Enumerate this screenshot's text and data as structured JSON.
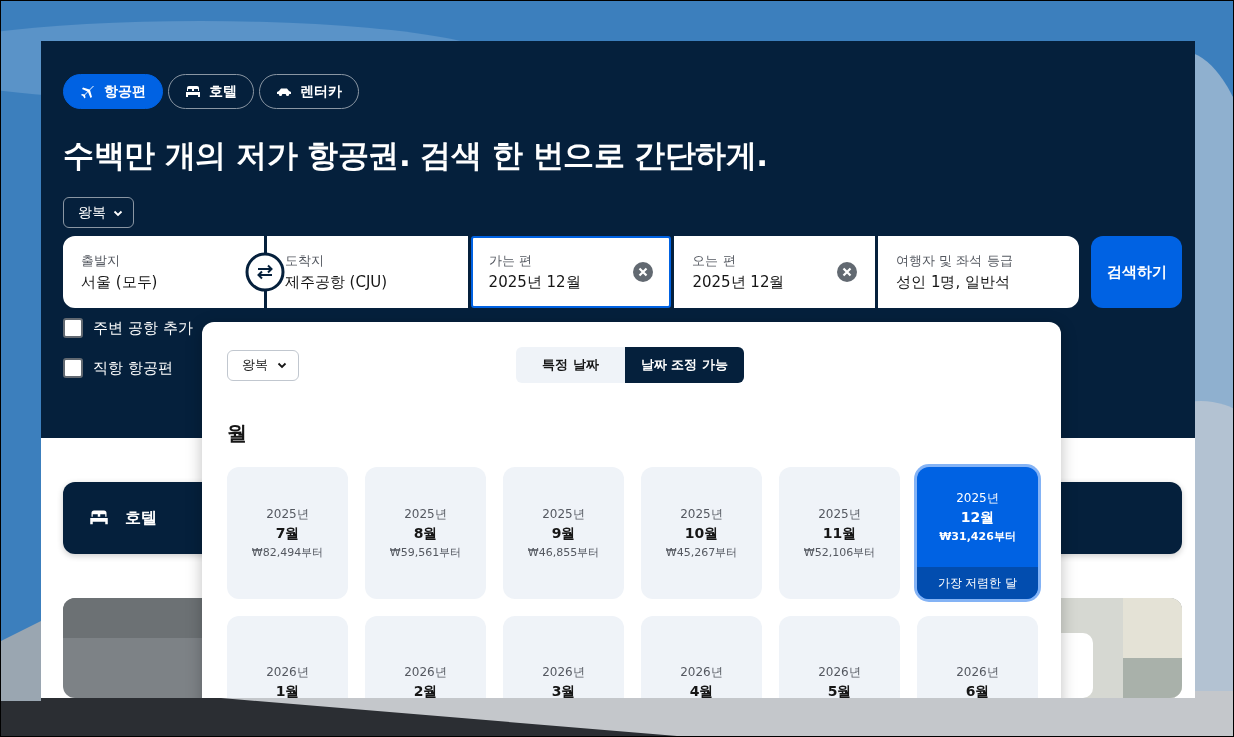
{
  "tabs": [
    {
      "label": "항공편",
      "kind": "plane",
      "selected": true
    },
    {
      "label": "호텔",
      "kind": "bed",
      "selected": false
    },
    {
      "label": "렌터카",
      "kind": "car",
      "selected": false
    }
  ],
  "headline": "수백만 개의 저가 항공권. 검색 한 번으로 간단하게.",
  "trip_type": "왕복",
  "fields": [
    {
      "label": "출발지",
      "value": "서울 (모두)",
      "selected": false,
      "clearable": false
    },
    {
      "label": "도착지",
      "value": "제주공항 (CJU)",
      "selected": false,
      "clearable": false
    },
    {
      "label": "가는 편",
      "value": "2025년 12월",
      "selected": true,
      "clearable": true
    },
    {
      "label": "오는 편",
      "value": "2025년 12월",
      "selected": false,
      "clearable": true
    },
    {
      "label": "여행자 및 좌석 등급",
      "value": "성인 1명, 일반석",
      "selected": false,
      "clearable": false
    }
  ],
  "search_button": "검색하기",
  "options": [
    {
      "label": "주변 공항 추가",
      "checked": false
    },
    {
      "label": "직항 항공편",
      "checked": false
    }
  ],
  "hotel_bar": {
    "label": "호텔"
  },
  "popup": {
    "trip_type": "왕복",
    "modes": [
      {
        "label": "특정 날짜",
        "selected": false
      },
      {
        "label": "날짜 조정 가능",
        "selected": true
      }
    ],
    "heading": "월",
    "months": [
      {
        "year": "2025년",
        "month": "7월",
        "price": "₩82,494부터",
        "selected": false
      },
      {
        "year": "2025년",
        "month": "8월",
        "price": "₩59,561부터",
        "selected": false
      },
      {
        "year": "2025년",
        "month": "9월",
        "price": "₩46,855부터",
        "selected": false
      },
      {
        "year": "2025년",
        "month": "10월",
        "price": "₩45,267부터",
        "selected": false
      },
      {
        "year": "2025년",
        "month": "11월",
        "price": "₩52,106부터",
        "selected": false
      },
      {
        "year": "2025년",
        "month": "12월",
        "price": "₩31,426부터",
        "selected": true,
        "badge": "가장 저렴한 달"
      },
      {
        "year": "2026년",
        "month": "1월",
        "selected": false
      },
      {
        "year": "2026년",
        "month": "2월",
        "selected": false
      },
      {
        "year": "2026년",
        "month": "3월",
        "selected": false
      },
      {
        "year": "2026년",
        "month": "4월",
        "selected": false
      },
      {
        "year": "2026년",
        "month": "5월",
        "selected": false
      },
      {
        "year": "2026년",
        "month": "6월",
        "selected": false
      }
    ]
  }
}
